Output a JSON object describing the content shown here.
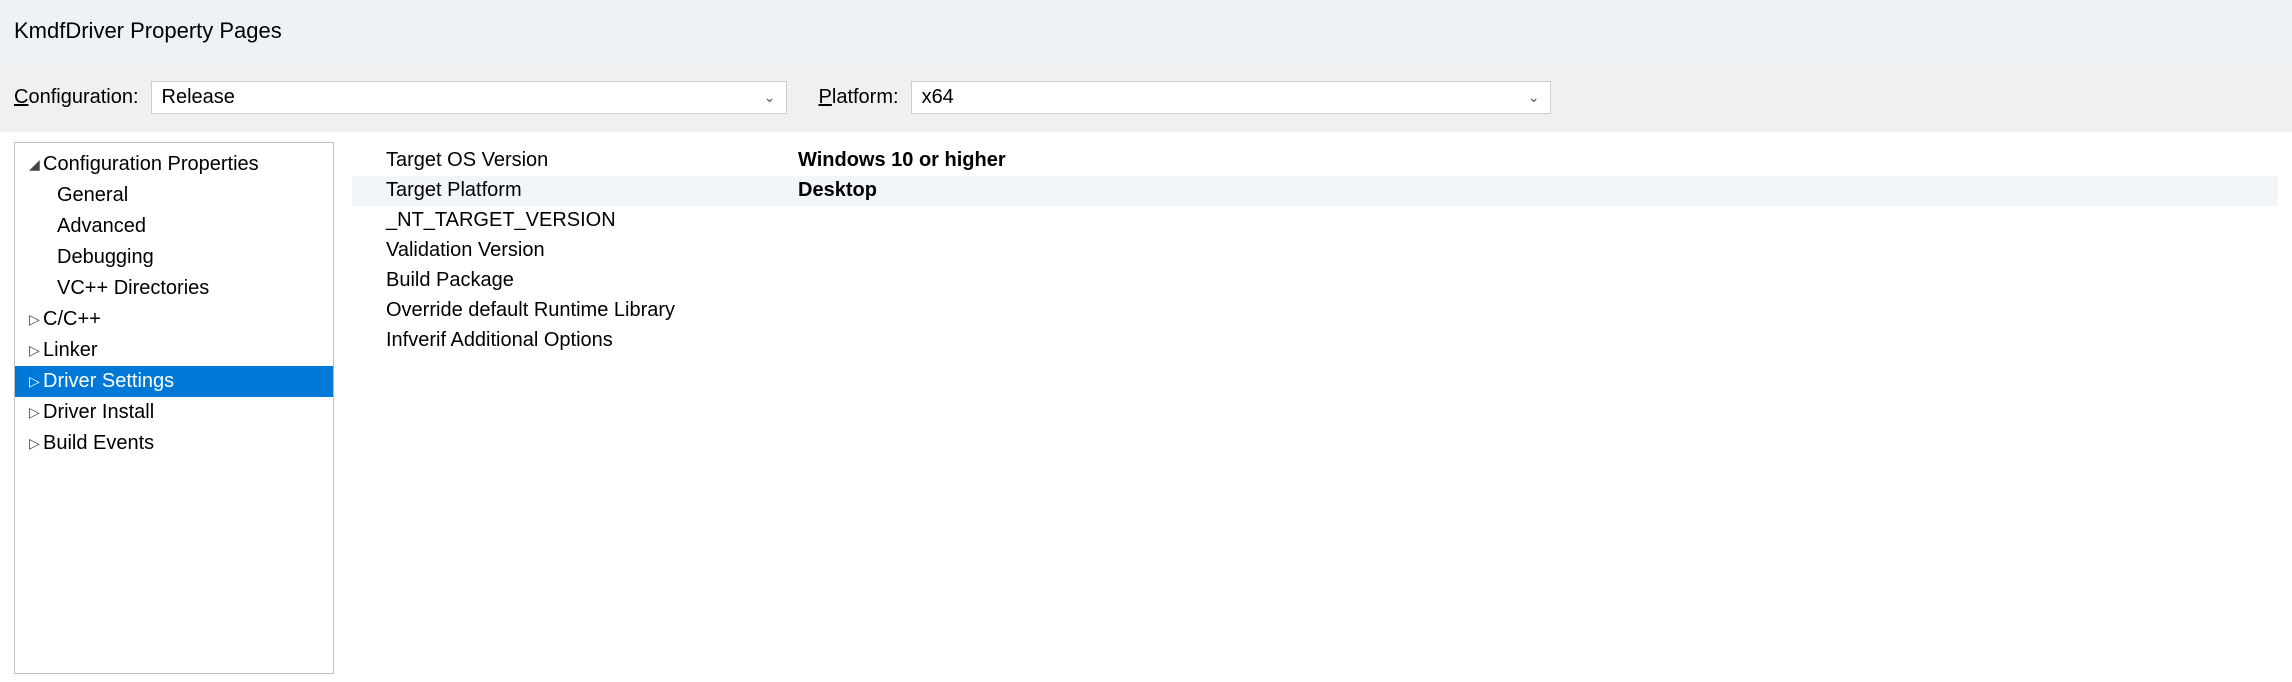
{
  "title": "KmdfDriver Property Pages",
  "config": {
    "label_pre": "C",
    "label_post": "onfiguration:",
    "value": "Release"
  },
  "platform": {
    "label_pre": "P",
    "label_post": "latform:",
    "value": "x64"
  },
  "tree": {
    "root": "Configuration Properties",
    "items": [
      {
        "label": "General",
        "caret": ""
      },
      {
        "label": "Advanced",
        "caret": ""
      },
      {
        "label": "Debugging",
        "caret": ""
      },
      {
        "label": "VC++ Directories",
        "caret": ""
      },
      {
        "label": "C/C++",
        "caret": "▷"
      },
      {
        "label": "Linker",
        "caret": "▷"
      },
      {
        "label": "Driver Settings",
        "caret": "▷"
      },
      {
        "label": "Driver Install",
        "caret": "▷"
      },
      {
        "label": "Build Events",
        "caret": "▷"
      }
    ]
  },
  "props": [
    {
      "name": "Target OS Version",
      "value": "Windows 10 or higher",
      "bold": true
    },
    {
      "name": "Target Platform",
      "value": "Desktop",
      "bold": true
    },
    {
      "name": "_NT_TARGET_VERSION",
      "value": "",
      "bold": false
    },
    {
      "name": "Validation Version",
      "value": "",
      "bold": false
    },
    {
      "name": "Build Package",
      "value": "",
      "bold": false
    },
    {
      "name": "Override default Runtime Library",
      "value": "",
      "bold": false
    },
    {
      "name": "Infverif Additional Options",
      "value": "",
      "bold": false
    }
  ]
}
